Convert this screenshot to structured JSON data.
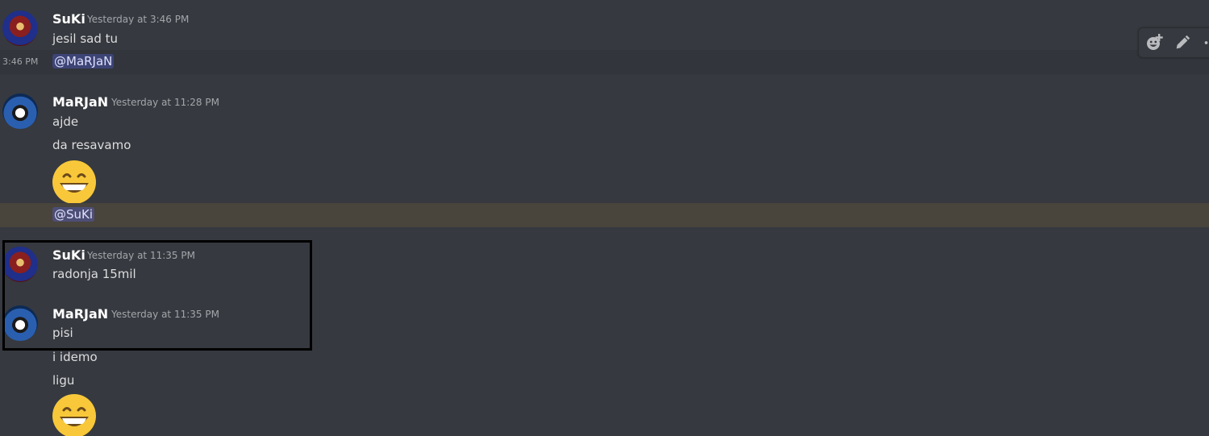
{
  "messages": {
    "group1": {
      "author": "SuKi",
      "timestamp": "Yesterday at 3:46 PM",
      "lines": [
        "jesil sad tu"
      ],
      "mention_side_time": "3:46 PM",
      "mention": "@MaRJaN"
    },
    "group2": {
      "author": "MaRJaN",
      "timestamp": "Yesterday at 11:28 PM",
      "lines": [
        "ajde",
        "da resavamo"
      ],
      "emoji": "grinning-face-emoji",
      "mention": "@SuKi"
    },
    "group3": {
      "author": "SuKi",
      "timestamp": "Yesterday at 11:35 PM",
      "lines": [
        "radonja 15mil"
      ]
    },
    "group4": {
      "author": "MaRJaN",
      "timestamp": "Yesterday at 11:35 PM",
      "lines": [
        "pisi",
        "i idemo",
        "ligu"
      ],
      "emoji": "grinning-face-emoji"
    }
  },
  "toolbar": {
    "icons": [
      "add-reaction-icon",
      "edit-icon",
      "more-icon"
    ]
  },
  "colors": {
    "background": "#36393f",
    "hover_row": "#32353b",
    "mention_highlight_row": "#49443c",
    "mention_pill": "#414675",
    "username": "#ffffff",
    "timestamp": "#a3a6aa",
    "message_text": "#dcddde",
    "selection_box": "#000000"
  }
}
